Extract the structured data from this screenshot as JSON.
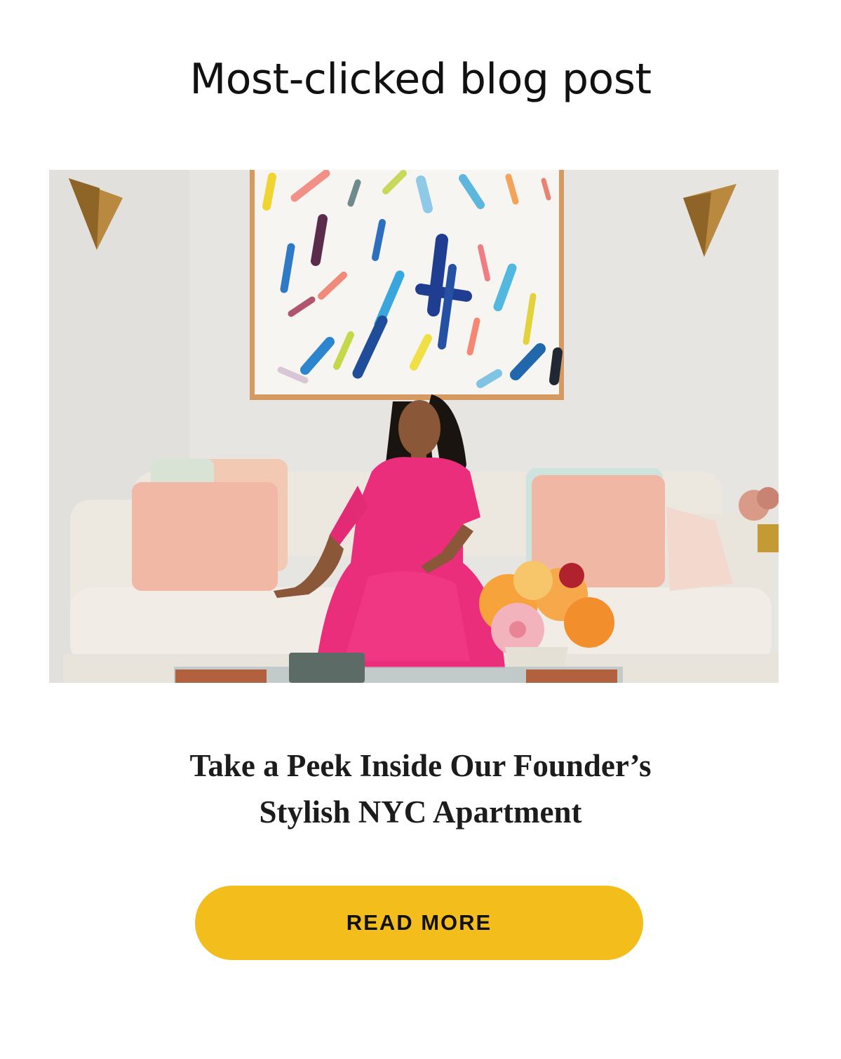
{
  "section": {
    "heading": "Most-clicked blog post"
  },
  "post": {
    "title_line1": "Take a Peek Inside Our Founder’s",
    "title_line2": "Stylish NYC Apartment",
    "cta_label": "READ MORE",
    "image_subject": "woman-in-pink-dress-on-sofa-photo"
  },
  "colors": {
    "cta_background": "#f3bd1c",
    "heading_text": "#111111",
    "background": "#ffffff"
  }
}
